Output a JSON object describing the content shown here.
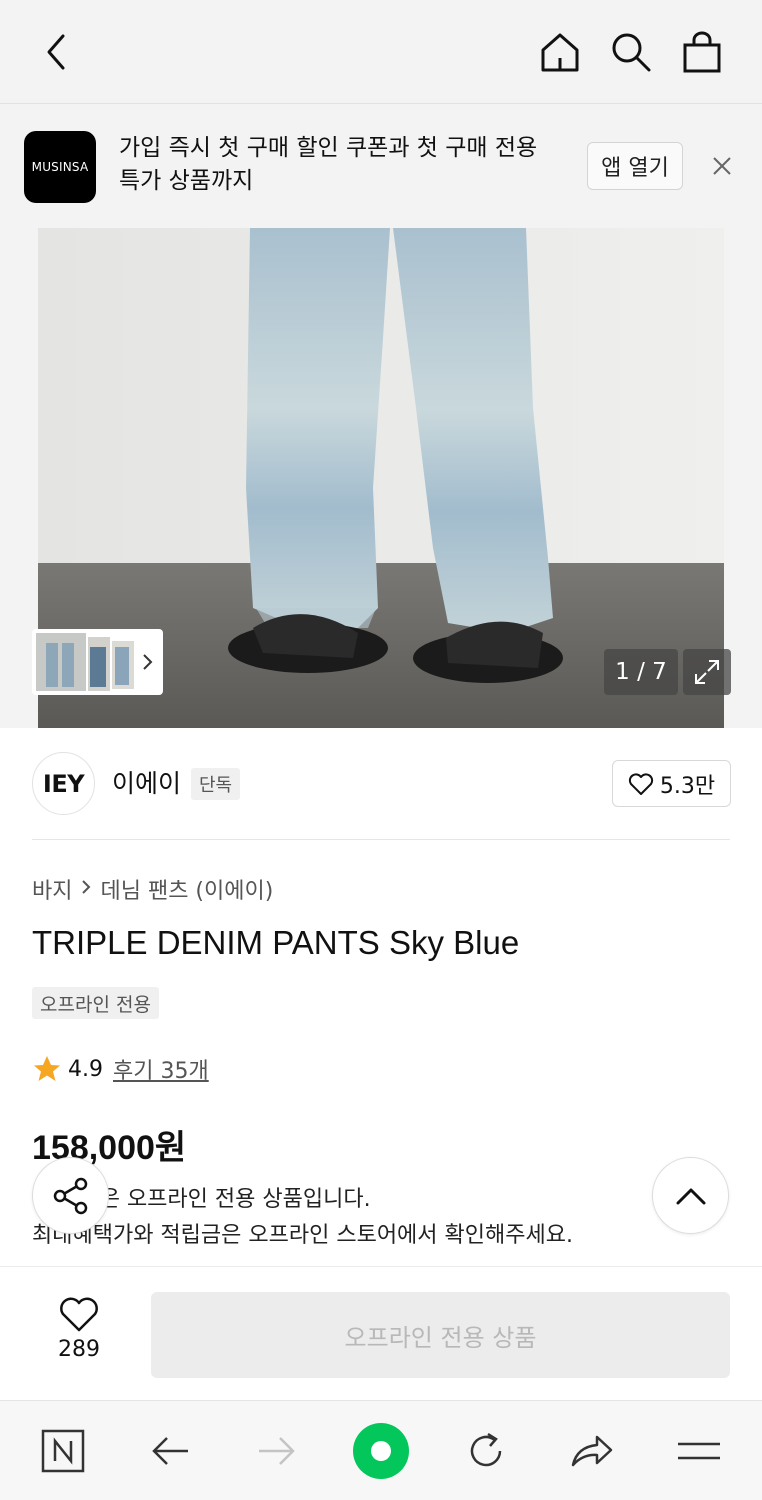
{
  "topbar": {
    "back_icon": "chevron-left-icon",
    "home_icon": "home-icon",
    "search_icon": "search-icon",
    "bag_icon": "shopping-bag-icon"
  },
  "promo": {
    "logo_text": "MUSINSA",
    "message": "가입 즉시 첫 구매 할인 쿠폰과 첫 구매 전용 특가 상품까지",
    "open_button": "앱 열기",
    "close_icon": "close-icon"
  },
  "gallery": {
    "counter": "1 / 7",
    "expand_icon": "expand-icon"
  },
  "brand": {
    "logo_text": "IEY",
    "name": "이에이",
    "badge": "단독",
    "like_count": "5.3만"
  },
  "product": {
    "breadcrumb": [
      "바지",
      "데님 팬츠 (이에이)"
    ],
    "title": "TRIPLE DENIM PANTS Sky Blue",
    "tag": "오프라인 전용",
    "rating": "4.9",
    "reviews": "후기 35개",
    "price": "158,000원",
    "notice_line1": "이 상품은 오프라인 전용 상품입니다.",
    "notice_line2": "최대혜택가와 적립금은 오프라인 스토어에서 확인해주세요."
  },
  "buybar": {
    "wish_count": "289",
    "buy_label": "오프라인 전용 상품"
  },
  "colors": {
    "star": "#f5a623",
    "accent_green": "#03c75a",
    "disabled_text": "#b8b8b8"
  }
}
